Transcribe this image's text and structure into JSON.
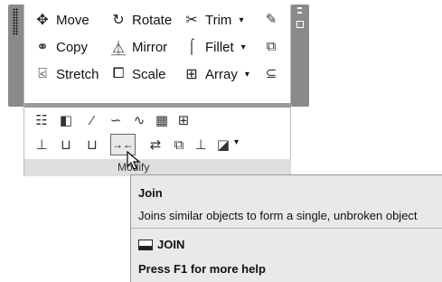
{
  "ribbon": {
    "tools": [
      {
        "name": "move",
        "label": "Move",
        "icon": "move-icon",
        "dropdown": false
      },
      {
        "name": "rotate",
        "label": "Rotate",
        "icon": "rotate-icon",
        "dropdown": false
      },
      {
        "name": "trim",
        "label": "Trim",
        "icon": "trim-icon",
        "dropdown": true
      },
      {
        "name": "copy",
        "label": "Copy",
        "icon": "copy-icon",
        "dropdown": false
      },
      {
        "name": "mirror",
        "label": "Mirror",
        "icon": "mirror-icon",
        "dropdown": false
      },
      {
        "name": "fillet",
        "label": "Fillet",
        "icon": "fillet-icon",
        "dropdown": true
      },
      {
        "name": "stretch",
        "label": "Stretch",
        "icon": "stretch-icon",
        "dropdown": false
      },
      {
        "name": "scale",
        "label": "Scale",
        "icon": "scale-icon",
        "dropdown": false
      },
      {
        "name": "array",
        "label": "Array",
        "icon": "array-icon",
        "dropdown": true
      }
    ],
    "panel_title": "Modify",
    "caret": "▾"
  },
  "tooltip": {
    "title": "Join",
    "description": "Joins similar objects to form a single, unbroken object",
    "command": "JOIN",
    "help": "Press F1 for more help"
  }
}
